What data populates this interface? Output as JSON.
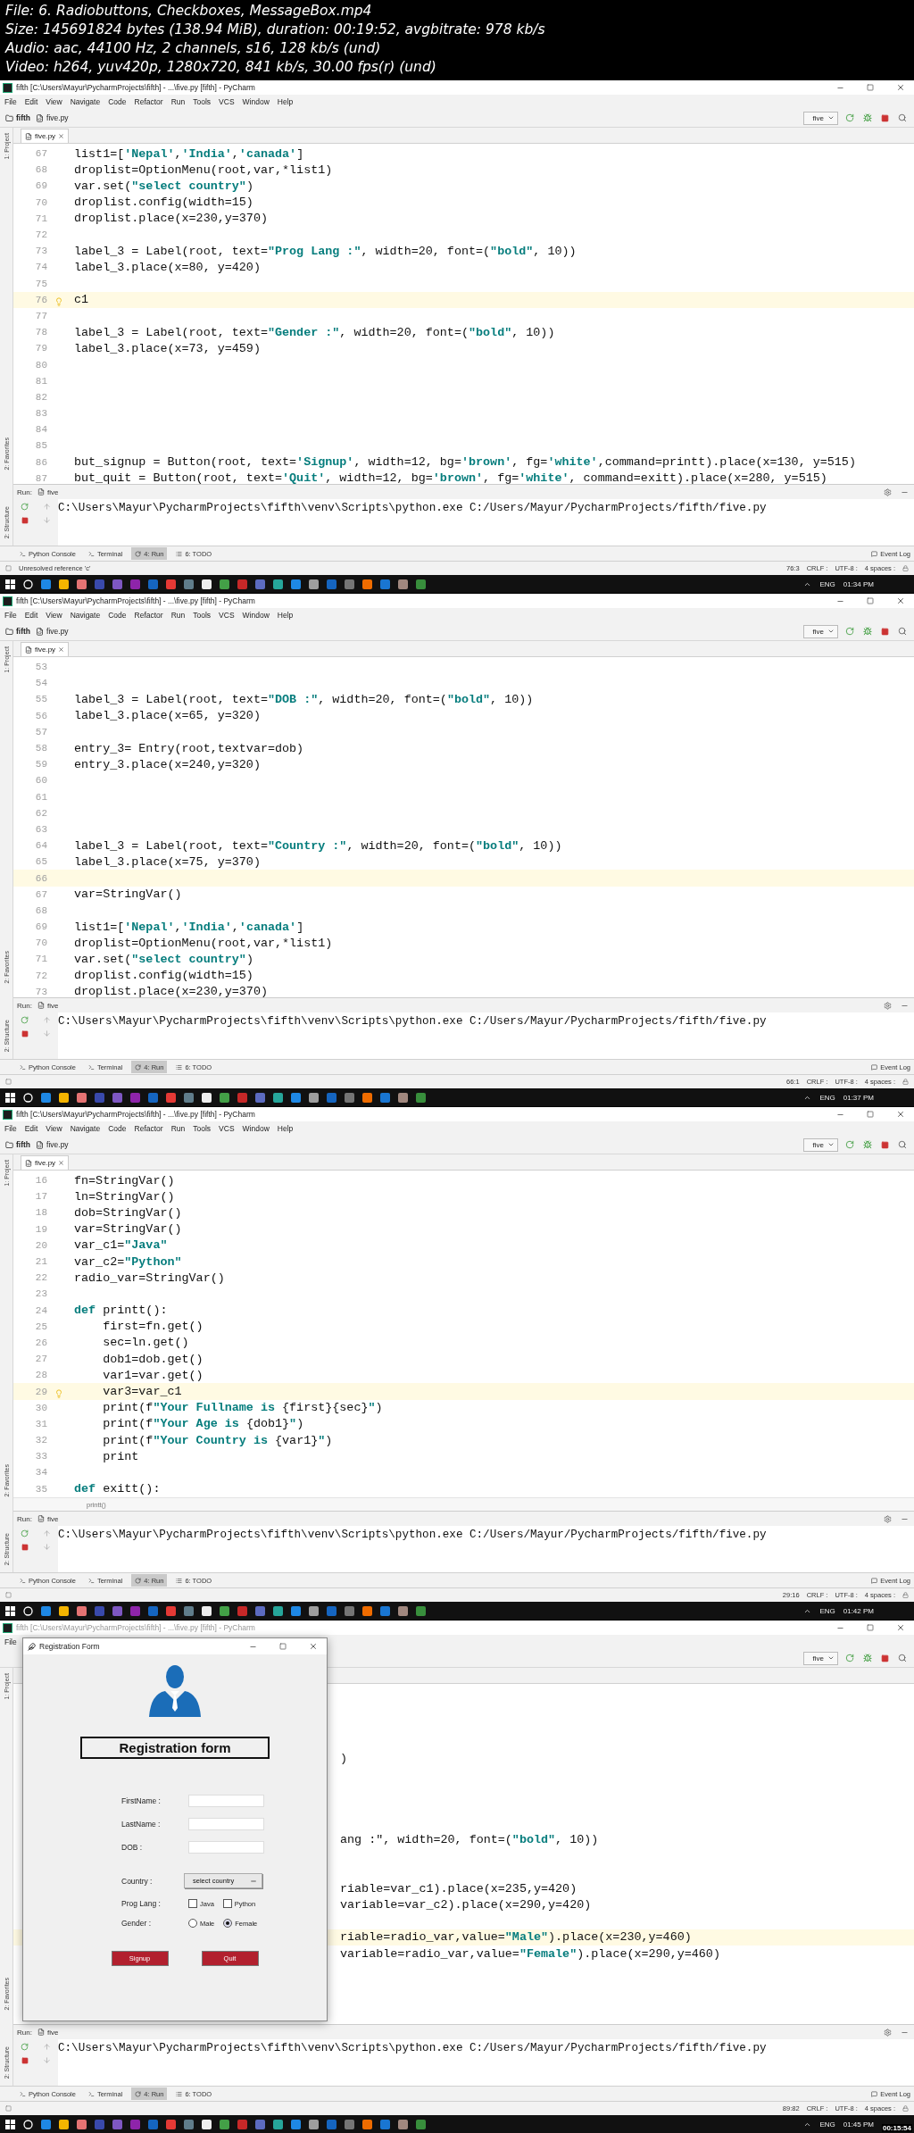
{
  "file_info": [
    "File: 6. Radiobuttons, Checkboxes, MessageBox.mp4",
    "Size: 145691824 bytes (138.94 MiB), duration: 00:19:52, avgbitrate: 978 kb/s",
    "Audio: aac, 44100 Hz, 2 channels, s16, 128 kb/s (und)",
    "Video: h264, yuv420p, 1280x720, 841 kb/s, 30.00 fps(r) (und)"
  ],
  "frames": [
    {
      "title": "fifth [C:\\Users\\Mayur\\PycharmProjects\\fifth] - ...\\five.py [fifth] - PyCharm",
      "menu": [
        "File",
        "Edit",
        "View",
        "Navigate",
        "Code",
        "Refactor",
        "Run",
        "Tools",
        "VCS",
        "Window",
        "Help"
      ],
      "breadcrumb": [
        "fifth",
        "five.py"
      ],
      "run_config": "five",
      "editor_tab": "five.py",
      "side_tabs": [
        "1: Project",
        "2: Favorites",
        "2: Structure"
      ],
      "lines": [
        {
          "num": "67",
          "text": "list1=[**'Nepal'**,**'India'**,**'canada'**]",
          "current": false
        },
        {
          "num": "68",
          "text": "droplist=OptionMenu(root,var,*list1)",
          "current": false
        },
        {
          "num": "69",
          "text": "var.set(**\"select country\"**)",
          "current": false
        },
        {
          "num": "70",
          "text": "droplist.config(width=15)",
          "current": false
        },
        {
          "num": "71",
          "text": "droplist.place(x=230,y=370)",
          "current": false
        },
        {
          "num": "72",
          "current": false
        },
        {
          "num": "73",
          "text": "label_3 = Label(root, text=**\"Prog Lang :\"**, width=20, font=(**\"bold\"**, 10))",
          "current": false
        },
        {
          "num": "74",
          "text": "label_3.place(x=80, y=420)",
          "current": false
        },
        {
          "num": "75",
          "current": false
        },
        {
          "num": "76",
          "text": "c1",
          "current": true
        },
        {
          "num": "77",
          "current": false
        },
        {
          "num": "78",
          "text": "label_3 = Label(root, text=**\"Gender :\"**, width=20, font=(**\"bold\"**, 10))",
          "current": false
        },
        {
          "num": "79",
          "text": "label_3.place(x=73, y=459)",
          "current": false
        },
        {
          "num": "80",
          "current": false
        },
        {
          "num": "81",
          "current": false
        },
        {
          "num": "82",
          "current": false
        },
        {
          "num": "83",
          "current": false
        },
        {
          "num": "84",
          "current": false
        },
        {
          "num": "85",
          "current": false
        },
        {
          "num": "86",
          "text": "but_signup = Button(root, text=**'Signup'**, width=12, bg=**'brown'**, fg=**'white'**,command=printt).place(x=130, y=515)",
          "current": false
        },
        {
          "num": "87",
          "text": "but_quit = Button(root, text=**'Quit'**, width=12, bg=**'brown'**, fg=**'white'**, command=exitt).place(x=280, y=515)",
          "current": false
        }
      ],
      "run": {
        "label": "Run:",
        "tab": "five",
        "output": "C:\\Users\\Mayur\\PycharmProjects\\fifth\\venv\\Scripts\\python.exe C:/Users/Mayur/PycharmProjects/fifth/five.py"
      },
      "tool_tabs": [
        {
          "label": "Python Console",
          "selected": false
        },
        {
          "label": "Terminal",
          "selected": false
        },
        {
          "label": "4: Run",
          "selected": true
        },
        {
          "label": "6: TODO",
          "selected": false
        }
      ],
      "event_log": "Event Log",
      "status_message": "Unresolved reference 'c'",
      "status": [
        "76:3",
        "CRLF :",
        "UTF-8 :",
        "4 spaces :"
      ],
      "taskbar": {
        "lang": "ENG",
        "clock": "01:34 PM"
      }
    },
    {
      "title": "fifth [C:\\Users\\Mayur\\PycharmProjects\\fifth] - ...\\five.py [fifth] - PyCharm",
      "menu": [
        "File",
        "Edit",
        "View",
        "Navigate",
        "Code",
        "Refactor",
        "Run",
        "Tools",
        "VCS",
        "Window",
        "Help"
      ],
      "breadcrumb": [
        "fifth",
        "five.py"
      ],
      "run_config": "five",
      "editor_tab": "five.py",
      "side_tabs": [
        "1: Project",
        "2: Favorites",
        "2: Structure"
      ],
      "lines": [
        {
          "num": "53",
          "current": false
        },
        {
          "num": "54",
          "current": false
        },
        {
          "num": "55",
          "text": "label_3 = Label(root, text=**\"DOB :\"**, width=20, font=(**\"bold\"**, 10))",
          "current": false
        },
        {
          "num": "56",
          "text": "label_3.place(x=65, y=320)",
          "current": false
        },
        {
          "num": "57",
          "current": false
        },
        {
          "num": "58",
          "text": "entry_3= Entry(root,textvar=dob)",
          "current": false
        },
        {
          "num": "59",
          "text": "entry_3.place(x=240,y=320)",
          "current": false
        },
        {
          "num": "60",
          "current": false
        },
        {
          "num": "61",
          "current": false
        },
        {
          "num": "62",
          "current": false
        },
        {
          "num": "63",
          "current": false
        },
        {
          "num": "64",
          "text": "label_3 = Label(root, text=**\"Country :\"**, width=20, font=(**\"bold\"**, 10))",
          "current": false
        },
        {
          "num": "65",
          "text": "label_3.place(x=75, y=370)",
          "current": false
        },
        {
          "num": "66",
          "current": true
        },
        {
          "num": "67",
          "text": "var=StringVar()",
          "current": false
        },
        {
          "num": "68",
          "current": false
        },
        {
          "num": "69",
          "text": "list1=[**'Nepal'**,**'India'**,**'canada'**]",
          "current": false
        },
        {
          "num": "70",
          "text": "droplist=OptionMenu(root,var,*list1)",
          "current": false
        },
        {
          "num": "71",
          "text": "var.set(**\"select country\"**)",
          "current": false
        },
        {
          "num": "72",
          "text": "droplist.config(width=15)",
          "current": false
        },
        {
          "num": "73",
          "text": "droplist.place(x=230,y=370)",
          "current": false
        }
      ],
      "run": {
        "label": "Run:",
        "tab": "five",
        "output": "C:\\Users\\Mayur\\PycharmProjects\\fifth\\venv\\Scripts\\python.exe C:/Users/Mayur/PycharmProjects/fifth/five.py"
      },
      "tool_tabs": [
        {
          "label": "Python Console",
          "selected": false
        },
        {
          "label": "Terminal",
          "selected": false
        },
        {
          "label": "4: Run",
          "selected": true
        },
        {
          "label": "6: TODO",
          "selected": false
        }
      ],
      "event_log": "Event Log",
      "status": [
        "66:1",
        "CRLF :",
        "UTF-8 :",
        "4 spaces :"
      ],
      "taskbar": {
        "lang": "ENG",
        "clock": "01:37 PM"
      }
    },
    {
      "title": "fifth [C:\\Users\\Mayur\\PycharmProjects\\fifth] - ...\\five.py [fifth] - PyCharm",
      "menu": [
        "File",
        "Edit",
        "View",
        "Navigate",
        "Code",
        "Refactor",
        "Run",
        "Tools",
        "VCS",
        "Window",
        "Help"
      ],
      "breadcrumb": [
        "fifth",
        "five.py"
      ],
      "run_config": "five",
      "editor_tab": "five.py",
      "side_tabs": [
        "1: Project",
        "2: Favorites",
        "2: Structure"
      ],
      "lines": [
        {
          "num": "16",
          "text": "fn=StringVar()",
          "current": false
        },
        {
          "num": "17",
          "text": "ln=StringVar()",
          "current": false
        },
        {
          "num": "18",
          "text": "dob=StringVar()",
          "current": false
        },
        {
          "num": "19",
          "text": "var=StringVar()",
          "current": false
        },
        {
          "num": "20",
          "text": "var_c1=**\"Java\"**",
          "current": false
        },
        {
          "num": "21",
          "text": "var_c2=**\"Python\"**",
          "current": false
        },
        {
          "num": "22",
          "text": "radio_var=StringVar()",
          "current": false
        },
        {
          "num": "23",
          "current": false
        },
        {
          "num": "24",
          "text": "**def** printt():",
          "current": false
        },
        {
          "num": "25",
          "text": "    first=fn.get()",
          "current": false
        },
        {
          "num": "26",
          "text": "    sec=ln.get()",
          "current": false
        },
        {
          "num": "27",
          "text": "    dob1=dob.get()",
          "current": false
        },
        {
          "num": "28",
          "text": "    var1=var.get()",
          "current": false
        },
        {
          "num": "29",
          "text": "    var3=var_c1",
          "current": true
        },
        {
          "num": "30",
          "text": "    print(f**\"Your Fullname is** {first}{sec}**\"**)",
          "current": false
        },
        {
          "num": "31",
          "text": "    print(f**\"Your Age is** {dob1}**\"**)",
          "current": false
        },
        {
          "num": "32",
          "text": "    print(f**\"Your Country is** {var1}**\"**)",
          "current": false
        },
        {
          "num": "33",
          "text": "    print",
          "current": false
        },
        {
          "num": "34",
          "current": false
        },
        {
          "num": "35",
          "text": "**def** exitt():",
          "current": false
        }
      ],
      "context": "printt()",
      "run": {
        "label": "Run:",
        "tab": "five",
        "output": "C:\\Users\\Mayur\\PycharmProjects\\fifth\\venv\\Scripts\\python.exe C:/Users/Mayur/PycharmProjects/fifth/five.py"
      },
      "tool_tabs": [
        {
          "label": "Python Console",
          "selected": false
        },
        {
          "label": "Terminal",
          "selected": false
        },
        {
          "label": "4: Run",
          "selected": true
        },
        {
          "label": "6: TODO",
          "selected": false
        }
      ],
      "event_log": "Event Log",
      "status": [
        "29:16",
        "CRLF :",
        "UTF-8 :",
        "4 spaces :"
      ],
      "taskbar": {
        "lang": "ENG",
        "clock": "01:42 PM"
      }
    },
    {
      "title": "fifth [C:\\Users\\Mayur\\PycharmProjects\\fifth] - ...\\five.py [fifth] - PyCharm",
      "menu": [
        "File"
      ],
      "run_config": "five",
      "side_tabs": [
        "1: Project",
        "2: Favorites",
        "2: Structure"
      ],
      "lines": [
        {
          "current": false
        },
        {
          "current": false
        },
        {
          "current": false
        },
        {
          "current": false
        },
        {
          "text": ")",
          "current": false
        },
        {
          "current": false
        },
        {
          "current": false
        },
        {
          "current": false
        },
        {
          "current": false
        },
        {
          "text": "ang :\", width=20, font=(**\"bold\"**, 10))",
          "current": false
        },
        {
          "current": false
        },
        {
          "current": false
        },
        {
          "text": "riable=var_c1).place(x=235,y=420)",
          "current": false
        },
        {
          "text": "variable=var_c2).place(x=290,y=420)",
          "current": false
        },
        {
          "current": false
        },
        {
          "text": "riable=radio_var,value=**\"Male\"**).place(x=230,y=460)",
          "current": true
        },
        {
          "text": "variable=radio_var,value=**\"Female\"**).place(x=290,y=460)",
          "current": false
        }
      ],
      "dialog": {
        "title": "Registration Form",
        "heading": "Registration form",
        "fields": [
          {
            "label": "FirstName :"
          },
          {
            "label": "LastName :"
          },
          {
            "label": "DOB :"
          }
        ],
        "country": {
          "label": "Country :",
          "value": "select country"
        },
        "prog_lang": {
          "label": "Prog Lang :",
          "options": [
            {
              "label": "Java",
              "checked": false
            },
            {
              "label": "Python",
              "checked": false
            }
          ]
        },
        "gender": {
          "label": "Gender :",
          "options": [
            {
              "label": "Male",
              "selected": false
            },
            {
              "label": "Female",
              "selected": true
            }
          ]
        },
        "buttons": [
          "Signup",
          "Quit"
        ]
      },
      "run": {
        "label": "Run:",
        "tab": "five",
        "output": "C:\\Users\\Mayur\\PycharmProjects\\fifth\\venv\\Scripts\\python.exe C:/Users/Mayur/PycharmProjects/fifth/five.py"
      },
      "tool_tabs": [
        {
          "label": "Python Console",
          "selected": false
        },
        {
          "label": "Terminal",
          "selected": false
        },
        {
          "label": "4: Run",
          "selected": true
        },
        {
          "label": "6: TODO",
          "selected": false
        }
      ],
      "event_log": "Event Log",
      "status": [
        "89:82",
        "CRLF :",
        "UTF-8 :",
        "4 spaces :"
      ],
      "taskbar": {
        "lang": "ENG",
        "clock": "01:45 PM"
      },
      "timestamp": "00:15:54"
    }
  ]
}
